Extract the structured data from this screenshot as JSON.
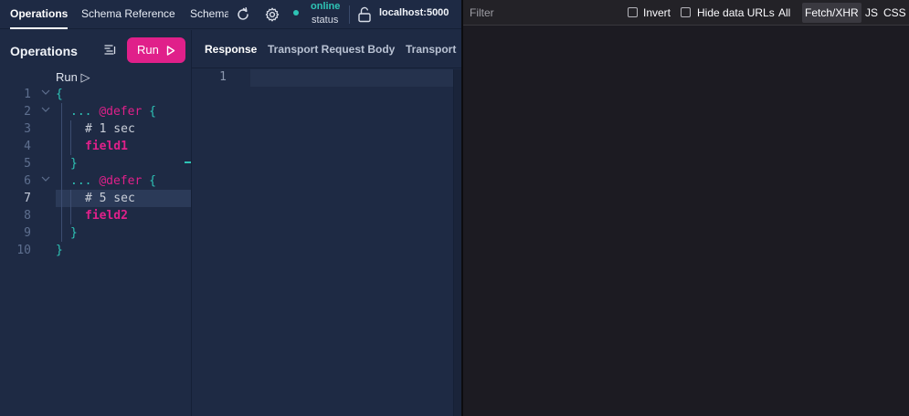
{
  "topbar": {
    "tabs": [
      "Operations",
      "Schema Reference",
      "Schema"
    ],
    "status": {
      "value": "online",
      "label": "status",
      "color": "#2ec4b6"
    },
    "host": "localhost:5000"
  },
  "operations": {
    "title": "Operations",
    "run_label": "Run",
    "codelens": "Run ▷",
    "current_line": 7,
    "lines": [
      {
        "n": "1",
        "indent": 0,
        "parts": [
          {
            "t": "{",
            "c": "brace"
          }
        ],
        "fold": true
      },
      {
        "n": "2",
        "indent": 1,
        "parts": [
          {
            "t": "... ",
            "c": "spread"
          },
          {
            "t": "@defer",
            "c": "dir"
          },
          {
            "t": " {",
            "c": "brace"
          }
        ],
        "fold": true
      },
      {
        "n": "3",
        "indent": 2,
        "parts": [
          {
            "t": "# 1 sec",
            "c": "comment"
          }
        ]
      },
      {
        "n": "4",
        "indent": 2,
        "parts": [
          {
            "t": "field1",
            "c": "field"
          }
        ]
      },
      {
        "n": "5",
        "indent": 1,
        "parts": [
          {
            "t": "}",
            "c": "brace"
          }
        ]
      },
      {
        "n": "6",
        "indent": 1,
        "parts": [
          {
            "t": "... ",
            "c": "spread"
          },
          {
            "t": "@defer",
            "c": "dir"
          },
          {
            "t": " {",
            "c": "brace"
          }
        ],
        "fold": true
      },
      {
        "n": "7",
        "indent": 2,
        "parts": [
          {
            "t": "# 5 sec",
            "c": "comment"
          }
        ]
      },
      {
        "n": "8",
        "indent": 2,
        "parts": [
          {
            "t": "field2",
            "c": "field"
          }
        ]
      },
      {
        "n": "9",
        "indent": 1,
        "parts": [
          {
            "t": "}",
            "c": "brace"
          }
        ]
      },
      {
        "n": "10",
        "indent": 0,
        "parts": [
          {
            "t": "}",
            "c": "brace"
          }
        ]
      }
    ]
  },
  "response": {
    "tabs": [
      "Response",
      "Transport Request Body",
      "Transport"
    ],
    "line_number": "1"
  },
  "devtools": {
    "filter_placeholder": "Filter",
    "invert_label": "Invert",
    "hide_data_urls_label": "Hide data URLs",
    "types": [
      "All",
      "Fetch/XHR",
      "JS",
      "CSS"
    ],
    "selected_type": "Fetch/XHR"
  },
  "colors": {
    "accent": "#e0208a",
    "teal": "#2ec4b6",
    "app_bg": "#1e2a44",
    "devtools_bg": "#1c1b22"
  }
}
